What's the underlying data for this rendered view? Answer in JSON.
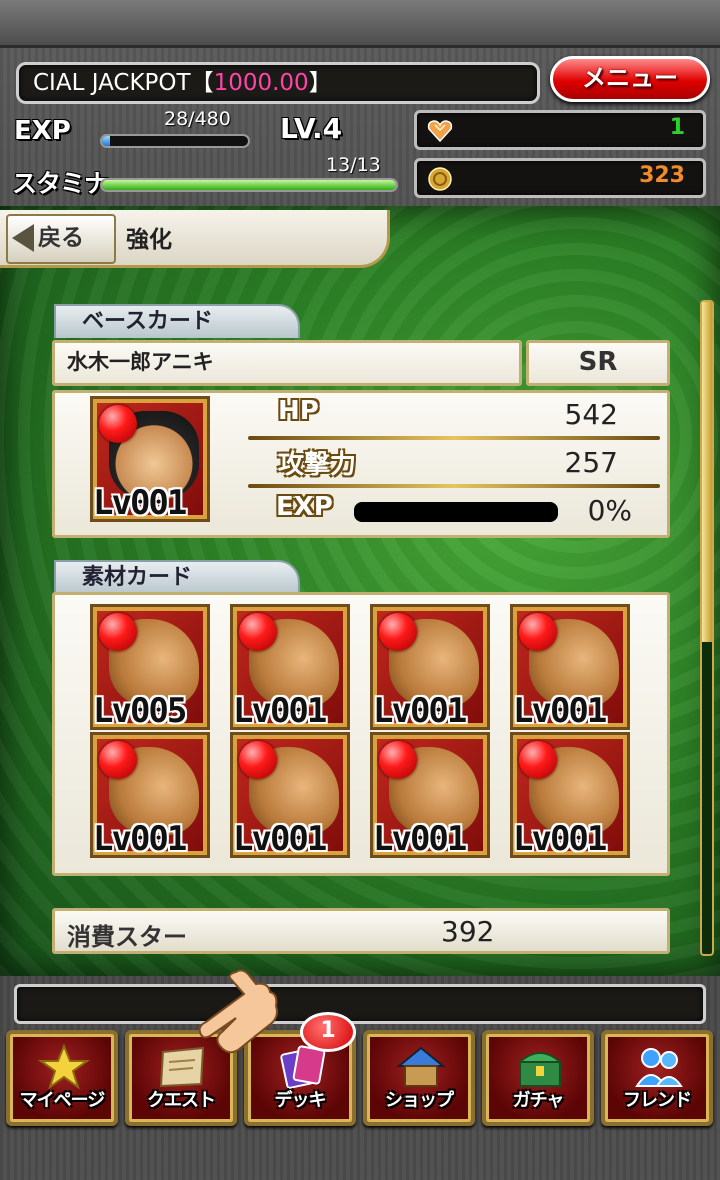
{
  "header": {
    "ticker_prefix": "CIAL JACKPOT【",
    "ticker_amount": "1000.00",
    "ticker_suffix": "】",
    "menu_label": "メニュー",
    "exp_label": "EXP",
    "exp_value": "28/480",
    "exp_fraction": 0.058,
    "level": "LV.4",
    "stamina_label": "スタミナ",
    "stamina_value": "13/13",
    "stamina_fraction": 1.0,
    "gems": "1",
    "coins": "323",
    "gem_color": "#2bd22b",
    "coin_color": "#f08c2a"
  },
  "page": {
    "back_label": "戻る",
    "title": "強化"
  },
  "base_card": {
    "section_label": "ベースカード",
    "name": "水木一郎アニキ",
    "rarity": "SR",
    "level": "Lv001",
    "stats": [
      {
        "label": "HP",
        "value": "542"
      },
      {
        "label": "攻撃力",
        "value": "257"
      }
    ],
    "exp_label": "EXP",
    "exp_percent_text": "0%",
    "exp_fraction": 0
  },
  "material_cards": {
    "section_label": "素材カード",
    "cards": [
      {
        "level": "Lv005"
      },
      {
        "level": "Lv001"
      },
      {
        "level": "Lv001"
      },
      {
        "level": "Lv001"
      },
      {
        "level": "Lv001"
      },
      {
        "level": "Lv001"
      },
      {
        "level": "Lv001"
      },
      {
        "level": "Lv001"
      }
    ]
  },
  "star_cost": {
    "label": "消費スター",
    "value": "392"
  },
  "nav": {
    "badge": "1",
    "items": [
      {
        "label": "マイページ",
        "icon": "star-icon"
      },
      {
        "label": "クエスト",
        "icon": "map-scroll-icon"
      },
      {
        "label": "デッキ",
        "icon": "cards-icon"
      },
      {
        "label": "ショップ",
        "icon": "house-icon"
      },
      {
        "label": "ガチャ",
        "icon": "treasure-chest-icon"
      },
      {
        "label": "フレンド",
        "icon": "friends-icon"
      }
    ]
  },
  "colors": {
    "accent_red": "#e10000",
    "board_green": "#2b7f25",
    "jackpot_pink": "#ff44a8"
  }
}
